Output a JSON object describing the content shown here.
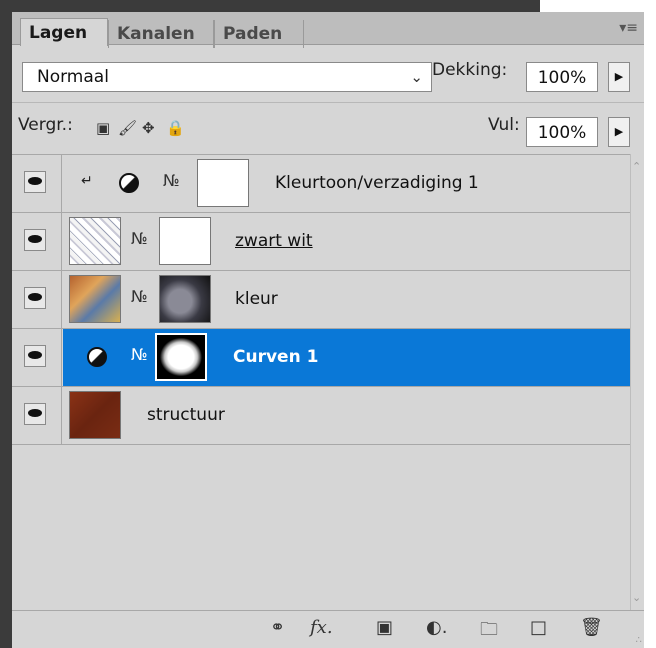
{
  "tabs": [
    {
      "label": "Lagen",
      "active": true
    },
    {
      "label": "Kanalen",
      "active": false
    },
    {
      "label": "Paden",
      "active": false
    }
  ],
  "blend": {
    "mode": "Normaal",
    "opacity_label": "Dekking:",
    "opacity_value": "100%"
  },
  "lock": {
    "label": "Vergr.:",
    "fill_label": "Vul:",
    "fill_value": "100%"
  },
  "layers": [
    {
      "name": "Kleurtoon/verzadiging 1",
      "type": "adjustment",
      "clipped": true,
      "selected": false,
      "visible": true
    },
    {
      "name": "zwart wit",
      "type": "pixel",
      "underlined": true,
      "selected": false,
      "visible": true
    },
    {
      "name": "kleur",
      "type": "pixel",
      "selected": false,
      "visible": true
    },
    {
      "name": "Curven 1",
      "type": "adjustment",
      "selected": true,
      "visible": true
    },
    {
      "name": "structuur",
      "type": "pixel",
      "selected": false,
      "visible": true
    }
  ],
  "colors": {
    "selection": "#0a78d7",
    "panel_bg": "#d6d6d6",
    "structuur_thumb": "#7a2a14"
  },
  "toolbar_icons": [
    "link-icon",
    "fx-icon",
    "mask-icon",
    "adjustment-icon",
    "group-folder-icon",
    "new-layer-icon",
    "trash-icon"
  ]
}
